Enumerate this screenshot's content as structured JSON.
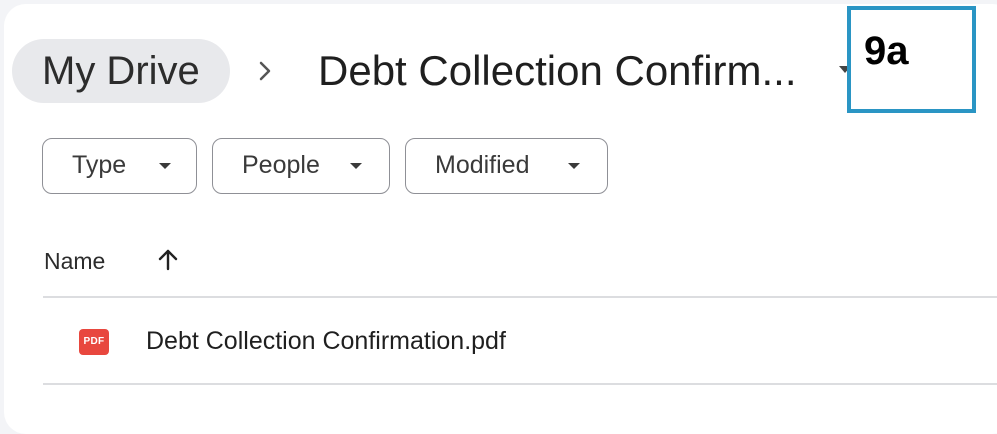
{
  "breadcrumb": {
    "root_label": "My Drive",
    "separator_icon": "chevron-right-icon",
    "current_label": "Debt Collection Confirm...",
    "current_caret_icon": "caret-down-icon"
  },
  "annotation": {
    "label": "9a",
    "border_color": "#2a95c4"
  },
  "filters": [
    {
      "label": "Type",
      "icon": "caret-down-icon"
    },
    {
      "label": "People",
      "icon": "caret-down-icon"
    },
    {
      "label": "Modified",
      "icon": "caret-down-icon"
    }
  ],
  "list": {
    "column_name_label": "Name",
    "sort_icon": "arrow-up-icon",
    "rows": [
      {
        "icon": "pdf-icon",
        "icon_text": "PDF",
        "icon_color": "#e8473e",
        "name": "Debt Collection Confirmation.pdf"
      }
    ]
  }
}
